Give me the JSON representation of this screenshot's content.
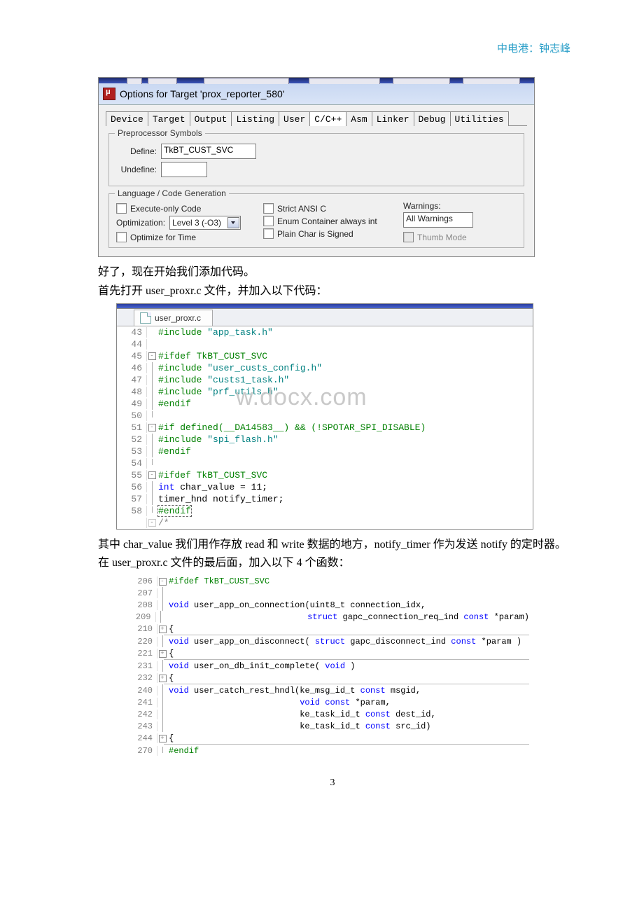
{
  "header_right": "中电港：钟志峰",
  "dialog": {
    "title": "Options for Target 'prox_reporter_580'",
    "tabs": [
      "Device",
      "Target",
      "Output",
      "Listing",
      "User",
      "C/C++",
      "Asm",
      "Linker",
      "Debug",
      "Utilities"
    ],
    "active_tab": "C/C++",
    "preproc_legend": "Preprocessor Symbols",
    "define_label": "Define:",
    "define_value": "TkBT_CUST_SVC",
    "undefine_label": "Undefine:",
    "codegen_legend": "Language / Code Generation",
    "cb_exec_only": "Execute-only Code",
    "opt_label": "Optimization:",
    "opt_value": "Level 3 (-O3)",
    "cb_opt_time": "Optimize for Time",
    "cb_strict_ansi": "Strict ANSI C",
    "cb_enum": "Enum Container always int",
    "cb_plain_char": "Plain Char is Signed",
    "warnings_label": "Warnings:",
    "warnings_value": "All Warnings",
    "cb_thumb": "Thumb Mode"
  },
  "text1": "好了，现在开始我们添加代码。",
  "text2_a": "首先打开 ",
  "text2_file": "user_proxr.c",
  "text2_b": " 文件，并加入以下代码：",
  "editor1": {
    "filename": "user_proxr.c",
    "lines": [
      {
        "n": "43",
        "fold": "",
        "seg": [
          {
            "cls": "c-pre",
            "t": "#include "
          },
          {
            "cls": "c-str",
            "t": "\"app_task.h\""
          }
        ]
      },
      {
        "n": "44",
        "fold": "",
        "seg": []
      },
      {
        "n": "45",
        "fold": "-",
        "seg": [
          {
            "cls": "c-pre",
            "t": "#ifdef TkBT_CUST_SVC"
          }
        ]
      },
      {
        "n": "46",
        "fold": "|",
        "seg": [
          {
            "cls": "c-pre",
            "t": "#include "
          },
          {
            "cls": "c-str",
            "t": "\"user_custs_config.h\""
          }
        ]
      },
      {
        "n": "47",
        "fold": "|",
        "seg": [
          {
            "cls": "c-pre",
            "t": "#include "
          },
          {
            "cls": "c-str",
            "t": "\"custs1_task.h\""
          }
        ]
      },
      {
        "n": "48",
        "fold": "|",
        "seg": [
          {
            "cls": "c-pre",
            "t": "#include "
          },
          {
            "cls": "c-str",
            "t": "\"prf_utils.h\""
          }
        ],
        "wm": true
      },
      {
        "n": "49",
        "fold": "|",
        "seg": [
          {
            "cls": "c-pre",
            "t": "#endif"
          }
        ]
      },
      {
        "n": "50",
        "fold": "L",
        "seg": [],
        "gray": true
      },
      {
        "n": "51",
        "fold": "-",
        "seg": [
          {
            "cls": "c-pre",
            "t": "#if defined(__DA14583__) && (!SPOTAR_SPI_DISABLE)"
          }
        ]
      },
      {
        "n": "52",
        "fold": "|",
        "seg": [
          {
            "cls": "c-pre",
            "t": "#include "
          },
          {
            "cls": "c-str",
            "t": "\"spi_flash.h\""
          }
        ]
      },
      {
        "n": "53",
        "fold": "|",
        "seg": [
          {
            "cls": "c-pre",
            "t": "#endif"
          }
        ]
      },
      {
        "n": "54",
        "fold": "L",
        "seg": []
      },
      {
        "n": "55",
        "fold": "-",
        "seg": [
          {
            "cls": "c-pre",
            "t": "#ifdef TkBT_CUST_SVC"
          }
        ]
      },
      {
        "n": "56",
        "fold": "|",
        "seg": [
          {
            "cls": "c-kw",
            "t": "int"
          },
          {
            "cls": "c-norm",
            "t": " char_value = "
          },
          {
            "cls": "c-num",
            "t": "11"
          },
          {
            "cls": "c-norm",
            "t": ";"
          }
        ]
      },
      {
        "n": "57",
        "fold": "|",
        "seg": [
          {
            "cls": "c-norm",
            "t": "timer_hnd notify_timer;"
          }
        ]
      },
      {
        "n": "58",
        "fold": "L",
        "seg": [
          {
            "cls": "c-pre sel",
            "t": "#endif"
          }
        ]
      }
    ],
    "trailing": "   /*"
  },
  "text3_a": "  其中 ",
  "text3_b": "char_value",
  "text3_c": " 我们用作存放 ",
  "text3_d": "read",
  "text3_e": " 和 ",
  "text3_f": "write",
  "text3_g": " 数据的地方，",
  "text3_h": "notify_timer",
  "text3_i": " 作为发送 ",
  "text3_j": "notify",
  "text3_k": " 的定时器。",
  "text4_a": "  在 ",
  "text4_b": "user_proxr.c",
  "text4_c": " 文件的最后面，加入以下 ",
  "text4_d": "4",
  "text4_e": " 个函数：",
  "editor2": {
    "lines": [
      {
        "n": "206",
        "fold": "-",
        "seg": [
          {
            "cls": "c-pre",
            "t": "#ifdef TkBT_CUST_SVC"
          }
        ]
      },
      {
        "n": "207",
        "fold": "|",
        "seg": []
      },
      {
        "n": "208",
        "fold": "|",
        "seg": [
          {
            "cls": "c-kw",
            "t": "void"
          },
          {
            "cls": "c-norm",
            "t": " user_app_on_connection("
          },
          {
            "cls": "c-norm",
            "t": "uint8_t connection_idx,"
          }
        ]
      },
      {
        "n": "209",
        "fold": "|",
        "seg": [
          {
            "cls": "c-norm",
            "t": "                            "
          },
          {
            "cls": "c-kw",
            "t": "struct"
          },
          {
            "cls": "c-norm",
            "t": " gapc_connection_req_ind "
          },
          {
            "cls": "c-kw",
            "t": "const"
          },
          {
            "cls": "c-norm",
            "t": " *param)"
          }
        ]
      },
      {
        "n": "210",
        "fold": "+",
        "seg": [
          {
            "cls": "c-norm",
            "t": "{"
          }
        ],
        "hr": true
      },
      {
        "n": "220",
        "fold": "|",
        "seg": [
          {
            "cls": "c-kw",
            "t": "void"
          },
          {
            "cls": "c-norm",
            "t": " user_app_on_disconnect( "
          },
          {
            "cls": "c-kw",
            "t": "struct"
          },
          {
            "cls": "c-norm",
            "t": " gapc_disconnect_ind "
          },
          {
            "cls": "c-kw",
            "t": "const"
          },
          {
            "cls": "c-norm",
            "t": " *param )"
          }
        ]
      },
      {
        "n": "221",
        "fold": "+",
        "seg": [
          {
            "cls": "c-norm",
            "t": "{"
          }
        ],
        "hr": true
      },
      {
        "n": "231",
        "fold": "|",
        "seg": [
          {
            "cls": "c-kw",
            "t": "void"
          },
          {
            "cls": "c-norm",
            "t": " user_on_db_init_complete( "
          },
          {
            "cls": "c-kw",
            "t": "void"
          },
          {
            "cls": "c-norm",
            "t": " )"
          }
        ]
      },
      {
        "n": "232",
        "fold": "+",
        "seg": [
          {
            "cls": "c-norm",
            "t": "{"
          }
        ],
        "hr": true
      },
      {
        "n": "240",
        "fold": "|",
        "seg": [
          {
            "cls": "c-kw",
            "t": "void"
          },
          {
            "cls": "c-norm",
            "t": " user_catch_rest_hndl(ke_msg_id_t "
          },
          {
            "cls": "c-kw",
            "t": "const"
          },
          {
            "cls": "c-norm",
            "t": " msgid,"
          }
        ]
      },
      {
        "n": "241",
        "fold": "|",
        "seg": [
          {
            "cls": "c-norm",
            "t": "                          "
          },
          {
            "cls": "c-kw",
            "t": "void"
          },
          {
            "cls": "c-norm",
            "t": " "
          },
          {
            "cls": "c-kw",
            "t": "const"
          },
          {
            "cls": "c-norm",
            "t": " *param,"
          }
        ]
      },
      {
        "n": "242",
        "fold": "|",
        "seg": [
          {
            "cls": "c-norm",
            "t": "                          ke_task_id_t "
          },
          {
            "cls": "c-kw",
            "t": "const"
          },
          {
            "cls": "c-norm",
            "t": " dest_id,"
          }
        ]
      },
      {
        "n": "243",
        "fold": "|",
        "seg": [
          {
            "cls": "c-norm",
            "t": "                          ke_task_id_t "
          },
          {
            "cls": "c-kw",
            "t": "const"
          },
          {
            "cls": "c-norm",
            "t": " src_id)"
          }
        ]
      },
      {
        "n": "244",
        "fold": "+",
        "seg": [
          {
            "cls": "c-norm",
            "t": "{"
          }
        ],
        "hr": true
      },
      {
        "n": "270",
        "fold": "L",
        "seg": [
          {
            "cls": "c-pre",
            "t": "#endif"
          }
        ]
      }
    ]
  },
  "page_num": "3",
  "watermark_text": "w.docx.com"
}
